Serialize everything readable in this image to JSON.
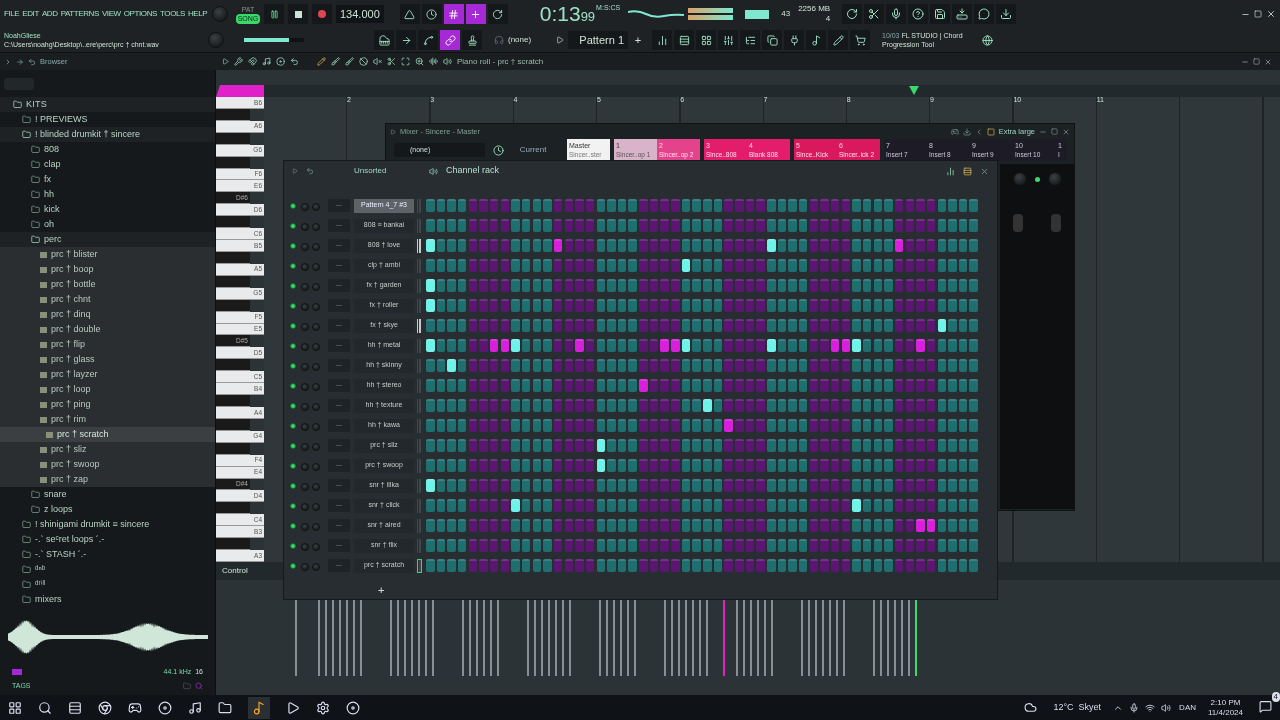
{
  "menu": [
    "FILE",
    "EDIT",
    "ADD",
    "PATTERNS",
    "VIEW",
    "OPTIONS",
    "TOOLS",
    "HELP"
  ],
  "transport": {
    "pat_label": "PAT",
    "song_label": "SONG",
    "song_selected": true,
    "tempo": "134.000",
    "time": "0:13",
    "time_fraction": "99",
    "time_unit": "M:S:CS",
    "toggles": [
      {
        "on": false
      },
      {
        "on": false
      },
      {
        "on": true
      },
      {
        "on": true
      },
      {
        "on": false
      }
    ]
  },
  "monitor": {
    "cpu": "43",
    "memory": "2256 MB",
    "polyphony": "4"
  },
  "hint": {
    "user": "NoahGliese",
    "path": "C:\\Users\\noahg\\Desktop\\..ere\\perc\\prc † chnt.wav"
  },
  "master_volume": {
    "level": 0.75
  },
  "tools": [
    {
      "on": false
    },
    {
      "on": false
    },
    {
      "on": false
    },
    {
      "on": true
    },
    {
      "on": false
    }
  ],
  "snap": "(none)",
  "pattern": "Pattern 1",
  "pattern_add": "+",
  "news": {
    "date": "10/03",
    "title": "FL STUDIO | Chord",
    "subtitle": "Progression Tool"
  },
  "browser": {
    "title": "Browser",
    "tree": [
      {
        "label": "KITS",
        "kind": "folder",
        "expanded": true,
        "selected": false,
        "children": [
          {
            "label": "!   PREVIEWS",
            "kind": "folder",
            "expanded": false,
            "selected": false
          },
          {
            "label": "! blinded drumkit † sincere",
            "kind": "folder",
            "expanded": true,
            "selected": false,
            "children": [
              {
                "label": "808",
                "kind": "folder",
                "expanded": false,
                "selected": false
              },
              {
                "label": "clap",
                "kind": "folder",
                "expanded": false,
                "selected": false
              },
              {
                "label": "fx",
                "kind": "folder",
                "expanded": false,
                "selected": false
              },
              {
                "label": "hh",
                "kind": "folder",
                "expanded": false,
                "selected": false
              },
              {
                "label": "kick",
                "kind": "folder",
                "expanded": false,
                "selected": false
              },
              {
                "label": "oh",
                "kind": "folder",
                "expanded": false,
                "selected": false
              },
              {
                "label": "perc",
                "kind": "folder",
                "expanded": true,
                "selected": false,
                "children": [
                  {
                    "label": "prc † blister",
                    "kind": "file",
                    "selected": false
                  },
                  {
                    "label": "prc † boop",
                    "kind": "file",
                    "selected": false
                  },
                  {
                    "label": "prc † bottle",
                    "kind": "file",
                    "selected": false
                  },
                  {
                    "label": "prc † chnt",
                    "kind": "file",
                    "selected": false
                  },
                  {
                    "label": "prc † dinq",
                    "kind": "file",
                    "selected": false
                  },
                  {
                    "label": "prc † double",
                    "kind": "file",
                    "selected": false
                  },
                  {
                    "label": "prc † flip",
                    "kind": "file",
                    "selected": false
                  },
                  {
                    "label": "prc † glass",
                    "kind": "file",
                    "selected": false
                  },
                  {
                    "label": "prc † layzer",
                    "kind": "file",
                    "selected": false
                  },
                  {
                    "label": "prc † loop",
                    "kind": "file",
                    "selected": false
                  },
                  {
                    "label": "prc † ping",
                    "kind": "file",
                    "selected": false
                  },
                  {
                    "label": "prc † rim",
                    "kind": "file",
                    "selected": false
                  },
                  {
                    "label": "prc † scratch",
                    "kind": "file",
                    "selected": true
                  },
                  {
                    "label": "prc † sliz",
                    "kind": "file",
                    "selected": false
                  },
                  {
                    "label": "prc † swoop",
                    "kind": "file",
                    "selected": false
                  },
                  {
                    "label": "prc † zap",
                    "kind": "file",
                    "selected": false
                  }
                ]
              },
              {
                "label": "snare",
                "kind": "folder",
                "expanded": false,
                "selected": false
              },
              {
                "label": "z loops",
                "kind": "folder",
                "expanded": false,
                "selected": false
              }
            ]
          },
          {
            "label": "! shinigami drumkit ≡ sincere",
            "kind": "folder",
            "expanded": false,
            "selected": false
          },
          {
            "label": "-.` seᶜret loops ´.-",
            "kind": "folder",
            "expanded": false,
            "selected": false
          },
          {
            "label": "-.` STASH ´.-",
            "kind": "folder",
            "expanded": false,
            "selected": false
          },
          {
            "label": "ᵈⁿᵇ",
            "kind": "folder",
            "expanded": false,
            "selected": false
          },
          {
            "label": "ᵈʳⁱˡˡ",
            "kind": "folder",
            "expanded": false,
            "selected": false
          },
          {
            "label": "mixers",
            "kind": "folder",
            "expanded": false,
            "selected": false
          }
        ]
      }
    ],
    "sample_rate": "44.1 kHz",
    "bit_depth": "16",
    "tags": "TAGS"
  },
  "piano_roll": {
    "title": "Piano roll - prc † scratch",
    "bars": [
      "2",
      "3",
      "4",
      "5",
      "6",
      "7",
      "8",
      "9",
      "10",
      "11"
    ],
    "control": "Control",
    "add": "+",
    "keys": [
      {
        "label": "B6",
        "kind": "white"
      },
      {
        "kind": "black"
      },
      {
        "label": "A6",
        "kind": "white"
      },
      {
        "kind": "black"
      },
      {
        "label": "G6",
        "kind": "white"
      },
      {
        "kind": "black"
      },
      {
        "label": "F6",
        "kind": "white"
      },
      {
        "label": "E6",
        "kind": "white"
      },
      {
        "label": "D#6",
        "kind": "black"
      },
      {
        "label": "D6",
        "kind": "white"
      },
      {
        "kind": "black"
      },
      {
        "label": "C6",
        "kind": "white"
      },
      {
        "label": "B5",
        "kind": "white"
      },
      {
        "kind": "black"
      },
      {
        "label": "A5",
        "kind": "white"
      },
      {
        "kind": "black"
      },
      {
        "label": "G5",
        "kind": "white"
      },
      {
        "kind": "black"
      },
      {
        "label": "F5",
        "kind": "white"
      },
      {
        "label": "E5",
        "kind": "white"
      },
      {
        "label": "D#5",
        "kind": "black"
      },
      {
        "label": "D5",
        "kind": "white"
      },
      {
        "kind": "black"
      },
      {
        "label": "C5",
        "kind": "white"
      },
      {
        "label": "B4",
        "kind": "white"
      },
      {
        "kind": "black"
      },
      {
        "label": "A4",
        "kind": "white"
      },
      {
        "kind": "black"
      },
      {
        "label": "G4",
        "kind": "white"
      },
      {
        "kind": "black"
      },
      {
        "label": "F4",
        "kind": "white"
      },
      {
        "label": "E4",
        "kind": "white"
      },
      {
        "label": "D#4",
        "kind": "black"
      },
      {
        "label": "D4",
        "kind": "white"
      },
      {
        "kind": "black"
      },
      {
        "label": "C4",
        "kind": "white"
      },
      {
        "label": "B3",
        "kind": "white"
      },
      {
        "kind": "black"
      },
      {
        "label": "A3",
        "kind": "white"
      }
    ]
  },
  "mixer": {
    "title": "Mixer - Sincere - Master",
    "route": "(none)",
    "current": "Current",
    "size": "Extra large",
    "inserts": [
      {
        "number": "Master",
        "name": "Sincer..ster",
        "color": "#f2f2f2"
      },
      {
        "number": "1",
        "name": "Sincer..op 1",
        "color": "#d9b3c9"
      },
      {
        "number": "2",
        "name": "Sincer..op 2",
        "color": "#e4428a"
      },
      {
        "number": "3",
        "name": "Since..808",
        "color": "#e31c6b"
      },
      {
        "number": "4",
        "name": "Blank 808",
        "color": "#e31c6b"
      },
      {
        "number": "5",
        "name": "Since..Kick",
        "color": "#d9195c"
      },
      {
        "number": "6",
        "name": "Sincer..ick 2",
        "color": "#d9195c"
      },
      {
        "number": "7",
        "name": "Insert 7",
        "color": "#1d1b26"
      },
      {
        "number": "8",
        "name": "Insert 8",
        "color": "#1d1b26"
      },
      {
        "number": "9",
        "name": "Insert 9",
        "color": "#1d1b26"
      },
      {
        "number": "10",
        "name": "Insert 10",
        "color": "#1d1b26"
      },
      {
        "number": "1",
        "name": "I",
        "color": "#1d1b26"
      }
    ]
  },
  "channel_rack": {
    "title": "Channel rack",
    "group": "Unsorted",
    "mixer_track": "---",
    "channels": [
      {
        "name": "Pattern 4_7 #3",
        "selected": true,
        "marked": false,
        "focused": false,
        "steps": [
          false,
          false,
          false,
          false,
          false,
          false,
          false,
          false,
          false,
          false,
          false,
          false,
          false,
          false,
          false,
          false,
          false,
          false,
          false,
          false,
          false,
          false,
          false,
          false,
          false,
          false,
          false,
          false,
          false,
          false,
          false,
          false,
          false,
          false,
          false,
          false,
          false,
          false,
          false,
          false,
          false,
          false,
          false,
          false,
          false,
          false,
          false,
          false,
          false,
          false,
          false,
          false
        ]
      },
      {
        "name": "808 ≡ bankai",
        "selected": false,
        "marked": false,
        "focused": false,
        "steps": [
          false,
          false,
          false,
          false,
          false,
          false,
          false,
          false,
          false,
          false,
          false,
          false,
          false,
          false,
          false,
          false,
          false,
          false,
          false,
          false,
          false,
          false,
          false,
          false,
          false,
          false,
          false,
          false,
          false,
          false,
          false,
          false,
          false,
          false,
          false,
          false,
          false,
          false,
          false,
          false,
          false,
          false,
          false,
          false,
          false,
          false,
          false,
          false,
          false,
          false,
          false,
          false
        ]
      },
      {
        "name": "808 † love",
        "selected": false,
        "marked": true,
        "focused": false,
        "steps": [
          true,
          false,
          false,
          false,
          false,
          false,
          false,
          false,
          false,
          false,
          false,
          false,
          true,
          false,
          false,
          false,
          false,
          false,
          false,
          false,
          false,
          false,
          false,
          false,
          false,
          false,
          false,
          false,
          false,
          false,
          false,
          false,
          true,
          false,
          false,
          false,
          false,
          false,
          false,
          false,
          false,
          false,
          false,
          false,
          true,
          false,
          false,
          false,
          false,
          false,
          false,
          false
        ]
      },
      {
        "name": "clp † ambi",
        "selected": false,
        "marked": false,
        "focused": false,
        "steps": [
          false,
          false,
          false,
          false,
          false,
          false,
          false,
          false,
          false,
          false,
          false,
          false,
          false,
          false,
          false,
          false,
          false,
          false,
          false,
          false,
          false,
          false,
          false,
          false,
          true,
          false,
          false,
          false,
          false,
          false,
          false,
          false,
          false,
          false,
          false,
          false,
          false,
          false,
          false,
          false,
          false,
          false,
          false,
          false,
          false,
          false,
          false,
          false,
          false,
          false,
          false,
          false
        ]
      },
      {
        "name": "fx † garden",
        "selected": false,
        "marked": false,
        "focused": false,
        "steps": [
          true,
          false,
          false,
          false,
          false,
          false,
          false,
          false,
          false,
          false,
          false,
          false,
          false,
          false,
          false,
          false,
          false,
          false,
          false,
          false,
          false,
          false,
          false,
          false,
          false,
          false,
          false,
          false,
          false,
          false,
          false,
          false,
          false,
          false,
          false,
          false,
          false,
          false,
          false,
          false,
          false,
          false,
          false,
          false,
          false,
          false,
          false,
          false,
          false,
          false,
          false,
          false
        ]
      },
      {
        "name": "fx † roller",
        "selected": false,
        "marked": false,
        "focused": false,
        "steps": [
          true,
          false,
          false,
          false,
          false,
          false,
          false,
          false,
          false,
          false,
          false,
          false,
          false,
          false,
          false,
          false,
          false,
          false,
          false,
          false,
          false,
          false,
          false,
          false,
          false,
          false,
          false,
          false,
          false,
          false,
          false,
          false,
          false,
          false,
          false,
          false,
          false,
          false,
          false,
          false,
          false,
          false,
          false,
          false,
          false,
          false,
          false,
          false,
          false,
          false,
          false,
          false
        ]
      },
      {
        "name": "fx † skye",
        "selected": false,
        "marked": true,
        "focused": false,
        "steps": [
          false,
          false,
          false,
          false,
          false,
          false,
          false,
          false,
          false,
          false,
          false,
          false,
          false,
          false,
          false,
          false,
          false,
          false,
          false,
          false,
          false,
          false,
          false,
          false,
          false,
          false,
          false,
          false,
          false,
          false,
          false,
          false,
          false,
          false,
          false,
          false,
          false,
          false,
          false,
          false,
          false,
          false,
          false,
          false,
          false,
          false,
          false,
          false,
          true,
          false,
          false,
          false
        ]
      },
      {
        "name": "hh † metal",
        "selected": false,
        "marked": false,
        "focused": false,
        "steps": [
          true,
          false,
          false,
          false,
          false,
          false,
          true,
          true,
          true,
          false,
          false,
          false,
          false,
          false,
          true,
          false,
          false,
          false,
          false,
          false,
          false,
          false,
          true,
          true,
          true,
          false,
          false,
          false,
          false,
          false,
          false,
          false,
          true,
          false,
          false,
          false,
          false,
          false,
          true,
          true,
          true,
          false,
          false,
          false,
          false,
          false,
          true,
          false,
          false,
          false,
          false,
          false
        ]
      },
      {
        "name": "hh † skinny",
        "selected": false,
        "marked": false,
        "focused": false,
        "steps": [
          false,
          false,
          true,
          false,
          false,
          false,
          false,
          false,
          false,
          false,
          false,
          false,
          false,
          false,
          false,
          false,
          false,
          false,
          false,
          false,
          false,
          false,
          false,
          false,
          false,
          false,
          false,
          false,
          false,
          false,
          false,
          false,
          false,
          false,
          false,
          false,
          false,
          false,
          false,
          false,
          false,
          false,
          false,
          false,
          false,
          false,
          false,
          false,
          false,
          false,
          false,
          false
        ]
      },
      {
        "name": "hh † stereo",
        "selected": false,
        "marked": false,
        "focused": false,
        "steps": [
          false,
          false,
          false,
          false,
          false,
          false,
          false,
          false,
          false,
          false,
          false,
          false,
          false,
          false,
          false,
          false,
          false,
          false,
          false,
          false,
          true,
          false,
          false,
          false,
          false,
          false,
          false,
          false,
          false,
          false,
          false,
          false,
          false,
          false,
          false,
          false,
          false,
          false,
          false,
          false,
          false,
          false,
          false,
          false,
          false,
          false,
          false,
          false,
          false,
          false,
          false,
          false
        ]
      },
      {
        "name": "hh † texture",
        "selected": false,
        "marked": false,
        "focused": false,
        "steps": [
          false,
          false,
          false,
          false,
          false,
          false,
          false,
          false,
          false,
          false,
          false,
          false,
          false,
          false,
          false,
          false,
          false,
          false,
          false,
          false,
          false,
          false,
          false,
          false,
          false,
          false,
          true,
          false,
          false,
          false,
          false,
          false,
          false,
          false,
          false,
          false,
          false,
          false,
          false,
          false,
          false,
          false,
          false,
          false,
          false,
          false,
          false,
          false,
          false,
          false,
          false,
          false
        ]
      },
      {
        "name": "hh † kawa",
        "selected": false,
        "marked": false,
        "focused": false,
        "steps": [
          false,
          false,
          false,
          false,
          false,
          false,
          false,
          false,
          false,
          false,
          false,
          false,
          false,
          false,
          false,
          false,
          false,
          false,
          false,
          false,
          false,
          false,
          false,
          false,
          false,
          false,
          false,
          false,
          true,
          false,
          false,
          false,
          false,
          false,
          false,
          false,
          false,
          false,
          false,
          false,
          false,
          false,
          false,
          false,
          false,
          false,
          false,
          false,
          false,
          false,
          false,
          false
        ]
      },
      {
        "name": "prc † sliz",
        "selected": false,
        "marked": false,
        "focused": false,
        "steps": [
          false,
          false,
          false,
          false,
          false,
          false,
          false,
          false,
          false,
          false,
          false,
          false,
          false,
          false,
          false,
          false,
          true,
          false,
          false,
          false,
          false,
          false,
          false,
          false,
          false,
          false,
          false,
          false,
          false,
          false,
          false,
          false,
          false,
          false,
          false,
          false,
          false,
          false,
          false,
          false,
          false,
          false,
          false,
          false,
          false,
          false,
          false,
          false,
          false,
          false,
          false,
          false
        ]
      },
      {
        "name": "prc † swoop",
        "selected": false,
        "marked": false,
        "focused": false,
        "steps": [
          false,
          false,
          false,
          false,
          false,
          false,
          false,
          false,
          false,
          false,
          false,
          false,
          false,
          false,
          false,
          false,
          true,
          false,
          false,
          false,
          false,
          false,
          false,
          false,
          false,
          false,
          false,
          false,
          false,
          false,
          false,
          false,
          false,
          false,
          false,
          false,
          false,
          false,
          false,
          false,
          false,
          false,
          false,
          false,
          false,
          false,
          false,
          false,
          false,
          false,
          false,
          false
        ]
      },
      {
        "name": "snr † illka",
        "selected": false,
        "marked": false,
        "focused": false,
        "steps": [
          true,
          false,
          false,
          false,
          false,
          false,
          false,
          false,
          false,
          false,
          false,
          false,
          false,
          false,
          false,
          false,
          false,
          false,
          false,
          false,
          false,
          false,
          false,
          false,
          false,
          false,
          false,
          false,
          false,
          false,
          false,
          false,
          false,
          false,
          false,
          false,
          false,
          false,
          false,
          false,
          false,
          false,
          false,
          false,
          false,
          false,
          false,
          false,
          false,
          false,
          false,
          false
        ]
      },
      {
        "name": "snr † click",
        "selected": false,
        "marked": false,
        "focused": false,
        "steps": [
          false,
          false,
          false,
          false,
          false,
          false,
          false,
          false,
          true,
          false,
          false,
          false,
          false,
          false,
          false,
          false,
          false,
          false,
          false,
          false,
          false,
          false,
          false,
          false,
          false,
          false,
          false,
          false,
          false,
          false,
          false,
          false,
          false,
          false,
          false,
          false,
          false,
          false,
          false,
          false,
          true,
          false,
          false,
          false,
          false,
          false,
          false,
          false,
          false,
          false,
          false,
          false
        ]
      },
      {
        "name": "snr † aired",
        "selected": false,
        "marked": false,
        "focused": false,
        "steps": [
          false,
          false,
          false,
          false,
          false,
          false,
          false,
          false,
          false,
          false,
          false,
          false,
          false,
          false,
          false,
          false,
          false,
          false,
          false,
          false,
          false,
          false,
          false,
          false,
          false,
          false,
          false,
          false,
          false,
          false,
          false,
          false,
          false,
          false,
          false,
          false,
          false,
          false,
          false,
          false,
          false,
          false,
          false,
          false,
          false,
          false,
          true,
          true,
          false,
          false,
          false,
          false
        ]
      },
      {
        "name": "snr † flix",
        "selected": false,
        "marked": false,
        "focused": false,
        "steps": [
          false,
          false,
          false,
          false,
          false,
          false,
          false,
          false,
          false,
          false,
          false,
          false,
          false,
          false,
          false,
          false,
          false,
          false,
          false,
          false,
          false,
          false,
          false,
          false,
          false,
          false,
          false,
          false,
          false,
          false,
          false,
          false,
          false,
          false,
          false,
          false,
          false,
          false,
          false,
          false,
          false,
          false,
          false,
          false,
          false,
          false,
          false,
          false,
          false,
          false,
          false,
          false
        ]
      },
      {
        "name": "prc † scratch",
        "selected": false,
        "marked": false,
        "focused": true,
        "steps": [
          false,
          false,
          false,
          false,
          false,
          false,
          false,
          false,
          false,
          false,
          false,
          false,
          false,
          false,
          false,
          false,
          false,
          false,
          false,
          false,
          false,
          false,
          false,
          false,
          false,
          false,
          false,
          false,
          false,
          false,
          false,
          false,
          false,
          false,
          false,
          false,
          false,
          false,
          false,
          false,
          false,
          false,
          false,
          false,
          false,
          false,
          false,
          false,
          false,
          false,
          false,
          false
        ]
      }
    ]
  },
  "taskbar": {
    "weather": "12°C  Skyet",
    "language": "DAN",
    "time": "2:10 PM",
    "date": "11/4/2024",
    "notifications": "4"
  }
}
